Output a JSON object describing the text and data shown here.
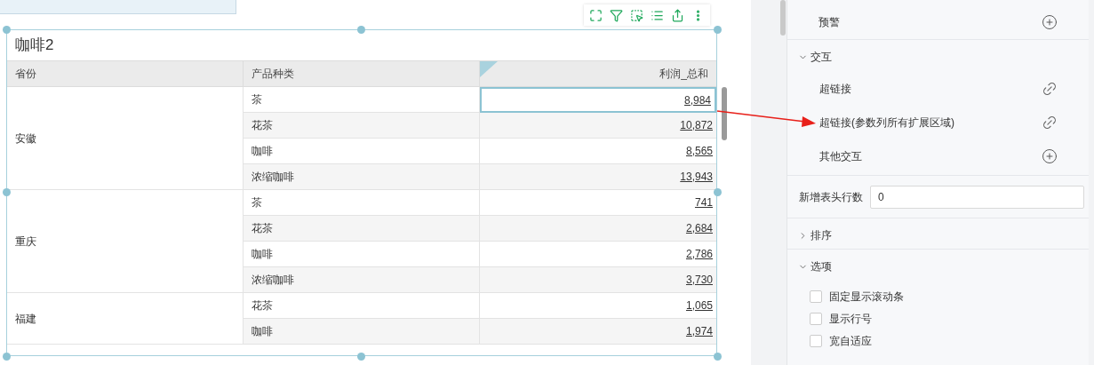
{
  "widget": {
    "title": "咖啡2",
    "columns": [
      "省份",
      "产品种类",
      "利润_总和"
    ],
    "groups": [
      {
        "province": "安徽",
        "rows": [
          {
            "product": "茶",
            "profit": "8,984",
            "selected": true
          },
          {
            "product": "花茶",
            "profit": "10,872",
            "selected": false
          },
          {
            "product": "咖啡",
            "profit": "8,565",
            "selected": false
          },
          {
            "product": "浓缩咖啡",
            "profit": "13,943",
            "selected": false
          }
        ]
      },
      {
        "province": "重庆",
        "rows": [
          {
            "product": "茶",
            "profit": "741",
            "selected": false
          },
          {
            "product": "花茶",
            "profit": "2,684",
            "selected": false
          },
          {
            "product": "咖啡",
            "profit": "2,786",
            "selected": false
          },
          {
            "product": "浓缩咖啡",
            "profit": "3,730",
            "selected": false
          }
        ]
      },
      {
        "province": "福建",
        "rows": [
          {
            "product": "花茶",
            "profit": "1,065",
            "selected": false
          },
          {
            "product": "咖啡",
            "profit": "1,974",
            "selected": false
          }
        ]
      }
    ]
  },
  "panel": {
    "items": [
      {
        "kind": "add",
        "label": "预警"
      },
      {
        "kind": "section",
        "label": "交互",
        "expanded": true,
        "children": [
          {
            "kind": "link",
            "label": "超链接"
          },
          {
            "kind": "link",
            "label": "超链接(参数列所有扩展区域)"
          },
          {
            "kind": "add",
            "label": "其他交互"
          }
        ]
      },
      {
        "kind": "field",
        "label": "新增表头行数",
        "value": "0"
      },
      {
        "kind": "section",
        "label": "排序",
        "expanded": false
      },
      {
        "kind": "section",
        "label": "选项",
        "expanded": true,
        "children": [
          {
            "kind": "checkbox",
            "label": "固定显示滚动条",
            "checked": false
          },
          {
            "kind": "checkbox",
            "label": "显示行号",
            "checked": false
          },
          {
            "kind": "checkbox",
            "label": "宽自适应",
            "checked": false
          }
        ]
      }
    ]
  }
}
